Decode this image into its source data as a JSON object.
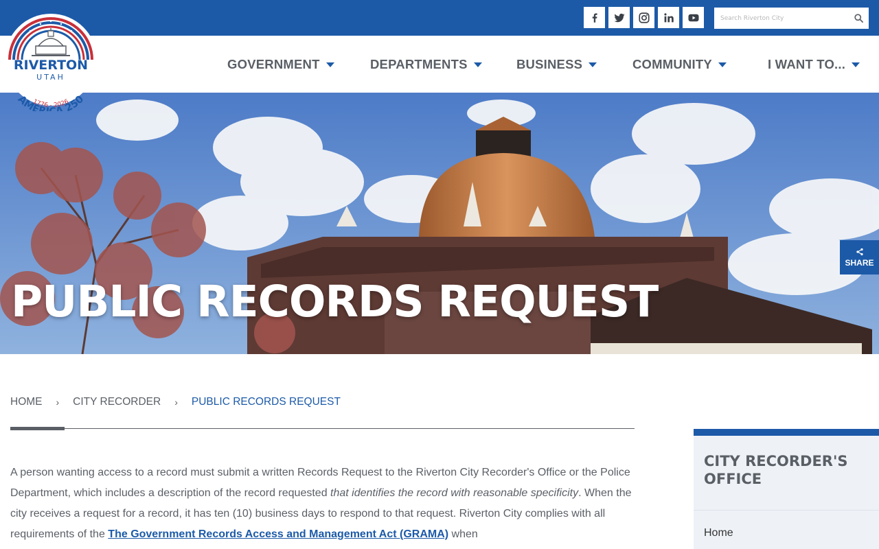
{
  "header": {
    "search_placeholder": "Search Riverton City",
    "social": [
      "facebook-icon",
      "twitter-icon",
      "instagram-icon",
      "linkedin-icon",
      "youtube-icon"
    ]
  },
  "logo": {
    "city": "RIVERTON",
    "state": "UTAH",
    "years": "1776 - 2026",
    "tagline": "AMERICA 250"
  },
  "nav": {
    "items": [
      {
        "label": "GOVERNMENT"
      },
      {
        "label": "DEPARTMENTS"
      },
      {
        "label": "BUSINESS"
      },
      {
        "label": "COMMUNITY"
      },
      {
        "label": "I WANT TO..."
      }
    ]
  },
  "hero": {
    "title": "PUBLIC RECORDS REQUEST"
  },
  "share": {
    "label": "SHARE"
  },
  "breadcrumb": {
    "items": [
      "HOME",
      "CITY RECORDER",
      "PUBLIC RECORDS REQUEST"
    ],
    "separator": "›"
  },
  "content": {
    "p1_a": "A person wanting access to a record must submit a written Records Request to the Riverton City Recorder's Office or the Police Department, which includes a description of the record requested ",
    "p1_em": "that identifies the record with reasonable specificity",
    "p1_b": ". When the city receives a request for a record, it has ten (10) business days to respond to that request. Riverton City complies with all requirements of the ",
    "p1_link": "The Government Records Access and Management Act (GRAMA)",
    "p1_c": " when"
  },
  "sidebar": {
    "title": "CITY RECORDER'S OFFICE",
    "links": [
      "Home"
    ]
  },
  "colors": {
    "brand_blue": "#1c5aa8",
    "nav_text": "#5a5f66",
    "sidebar_bg": "#eef2f7"
  }
}
